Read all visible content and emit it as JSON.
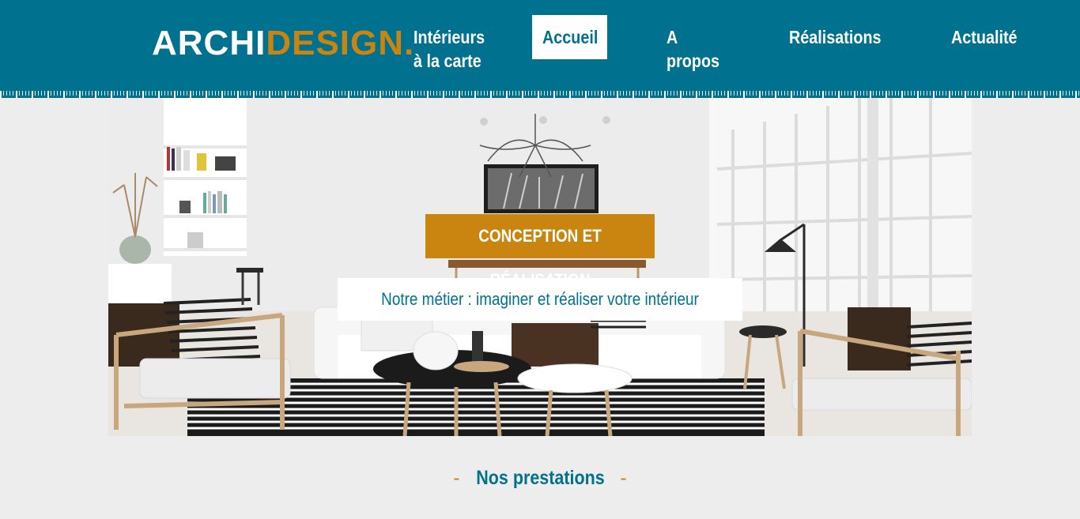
{
  "brand": {
    "part1": "ARCHI",
    "part2": "DESIGN.",
    "colors": {
      "primary": "#00718e",
      "accent": "#c98510"
    }
  },
  "nav": {
    "items": [
      {
        "line1": "Intérieurs",
        "line2": "à la carte"
      },
      {
        "line1": "Accueil"
      },
      {
        "line1": "A",
        "line2": "propos"
      },
      {
        "line1": "Réalisations"
      },
      {
        "line1": "Actualité"
      }
    ],
    "active": "Accueil"
  },
  "hero": {
    "badge": "CONCEPTION ET RÉALISATION",
    "tagline": "Notre métier : imaginer et réaliser votre intérieur"
  },
  "section": {
    "dash_left": "-",
    "title": "Nos prestations",
    "dash_right": "-"
  }
}
